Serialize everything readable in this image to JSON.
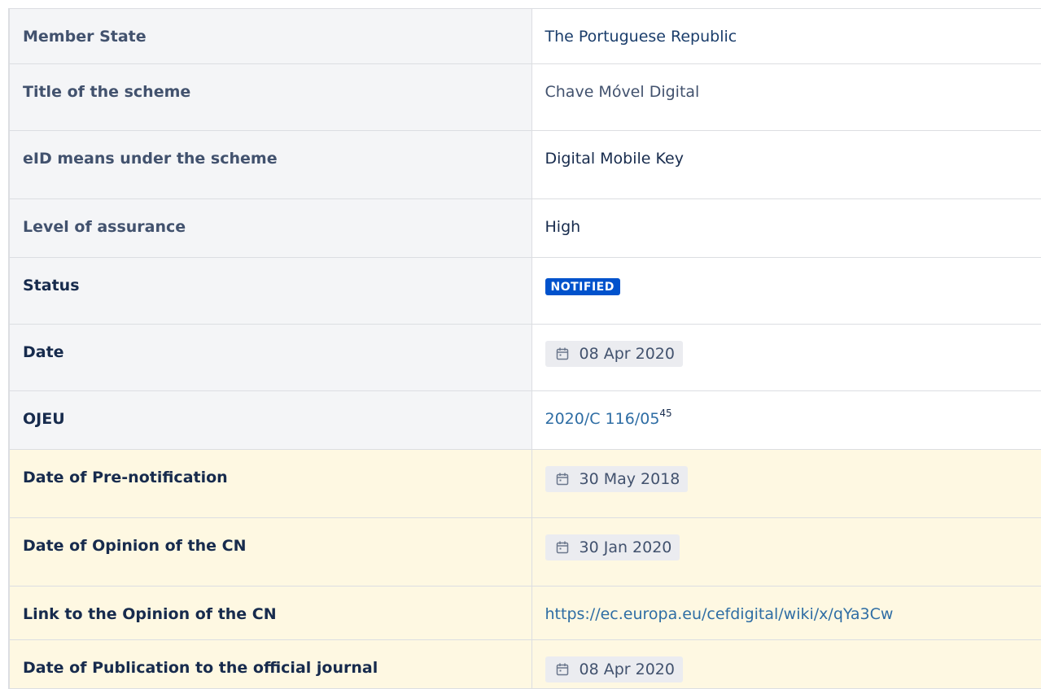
{
  "rows": [
    {
      "key": "Member State",
      "value": "The Portuguese Republic"
    },
    {
      "key": "Title of the scheme",
      "value": "Chave Móvel Digital"
    },
    {
      "key": "eID means under the scheme",
      "value": "Digital Mobile Key"
    },
    {
      "key": "Level of assurance",
      "value": "High"
    },
    {
      "key": "Status",
      "value": "NOTIFIED"
    },
    {
      "key": "Date",
      "value": "08 Apr 2020"
    },
    {
      "key": "OJEU",
      "value": "2020/C 116/05",
      "footnote": "45"
    },
    {
      "key": "Date of Pre-notification",
      "value": "30 May 2018"
    },
    {
      "key": "Date of Opinion of the CN",
      "value": "30 Jan 2020"
    },
    {
      "key": "Link to the Opinion of the CN",
      "value": "https://ec.europa.eu/cefdigital/wiki/x/qYa3Cw"
    },
    {
      "key": "Date of Publication to the official journal",
      "value": "08 Apr 2020"
    }
  ],
  "icons": {
    "date": "calendar-icon"
  },
  "colors": {
    "status_lozenge": "#0052cc",
    "highlight_row": "#fef8e2",
    "key_column": "#f4f5f7",
    "link": "#2e6da4"
  }
}
